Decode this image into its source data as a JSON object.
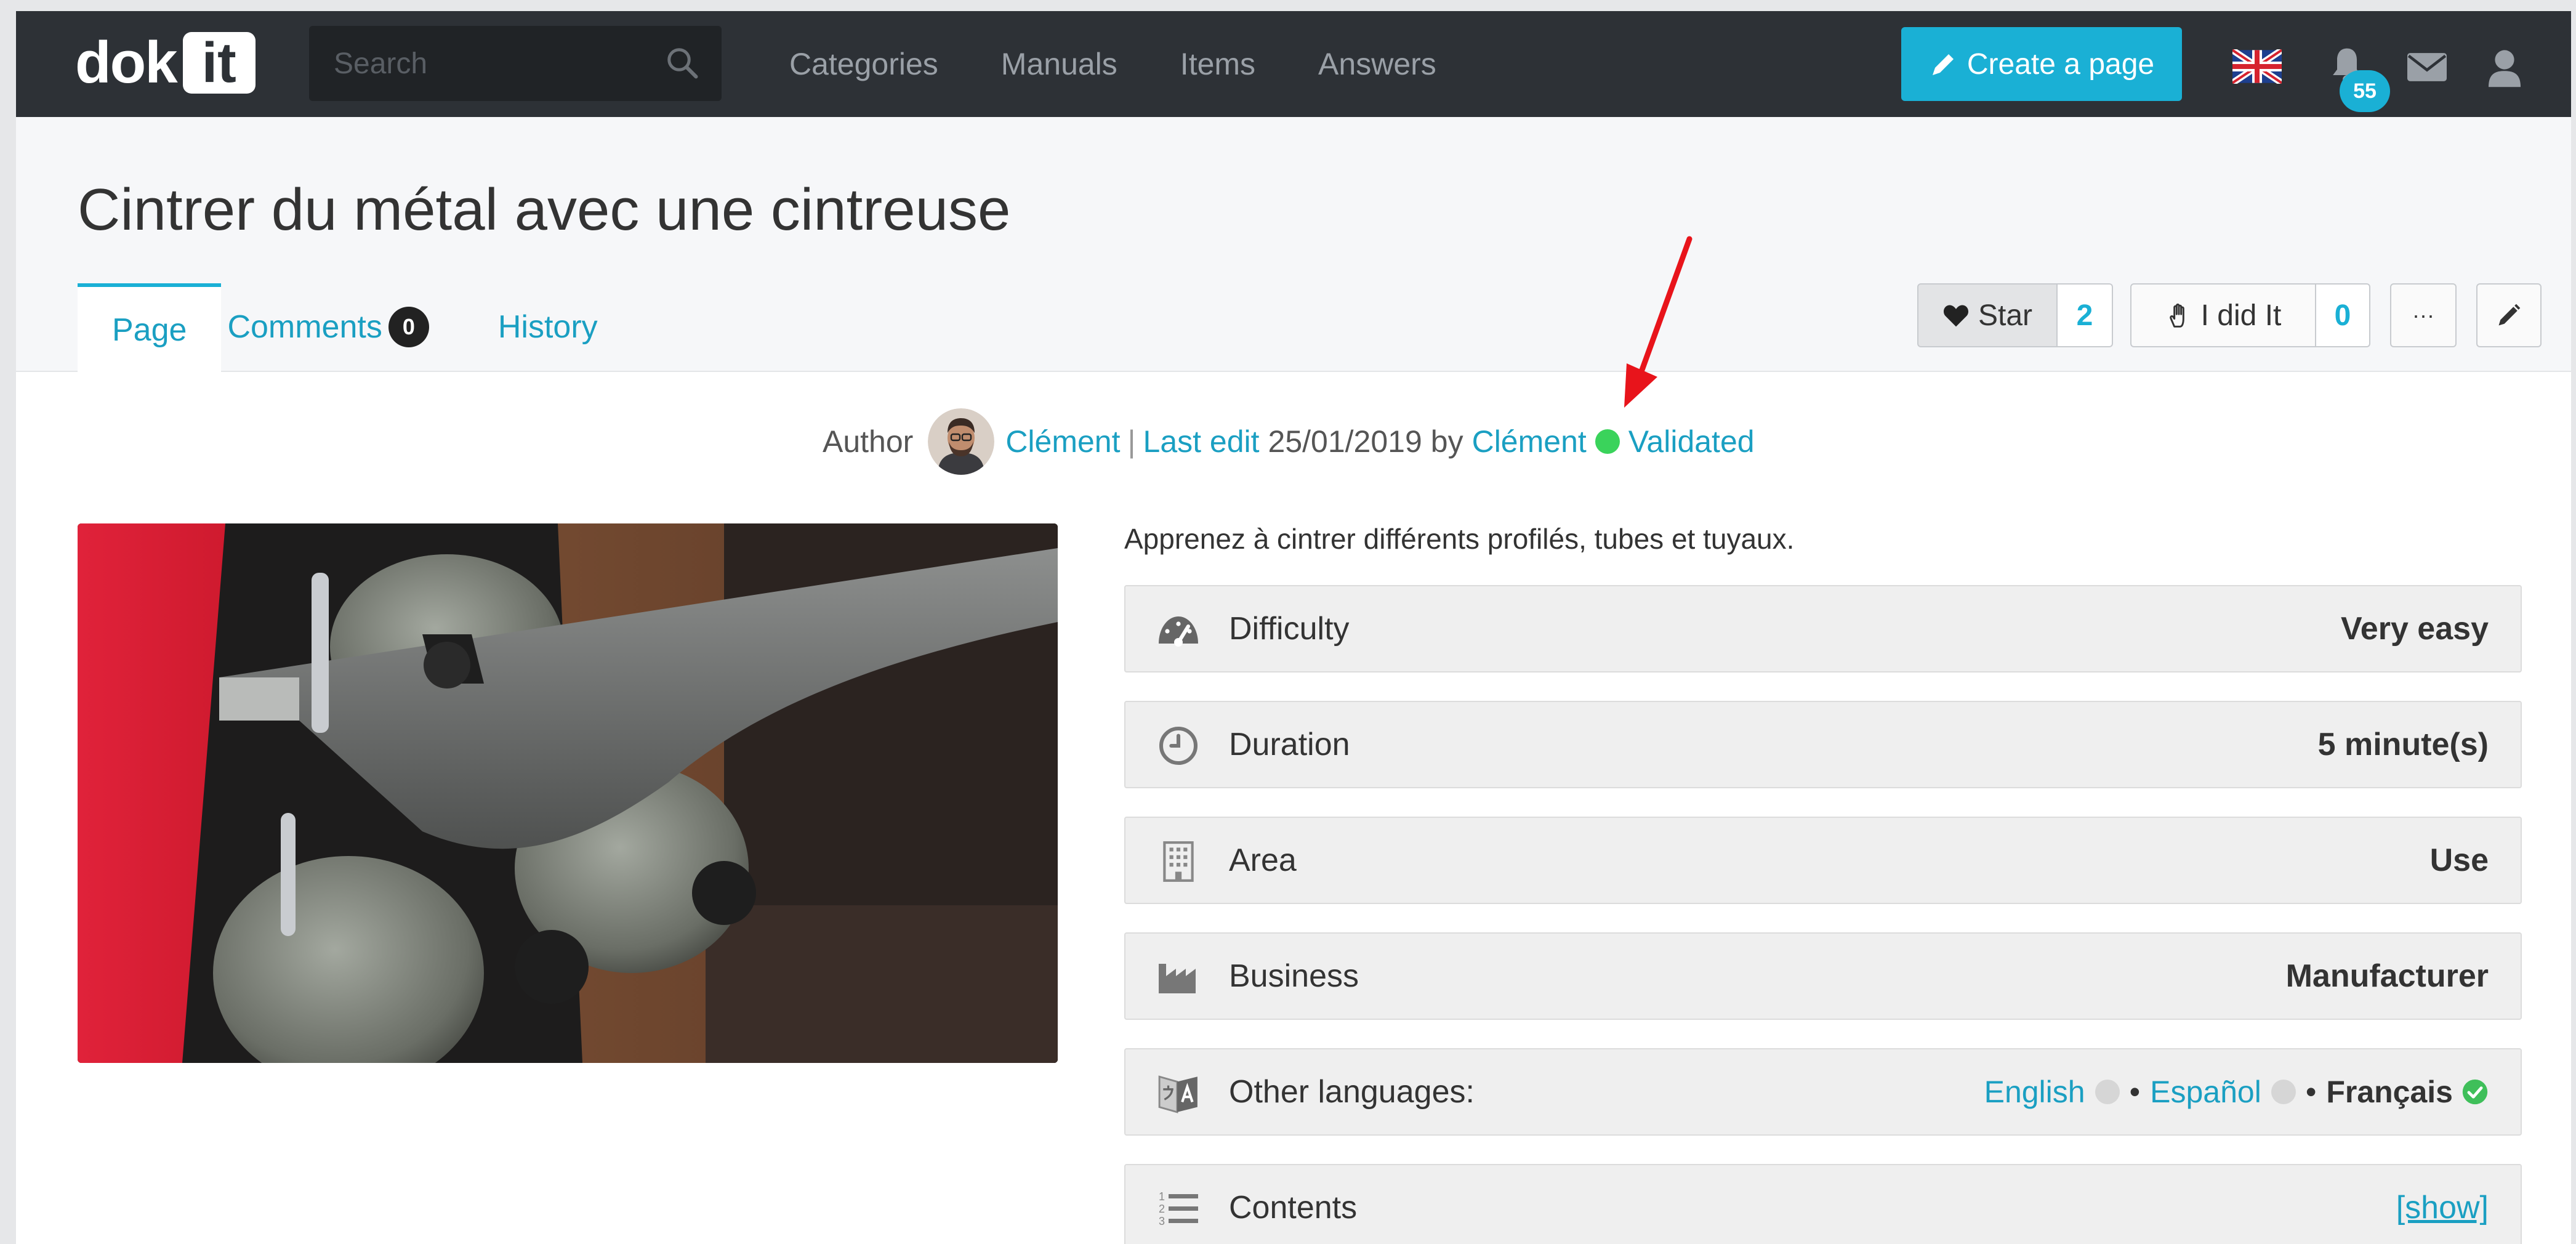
{
  "brand": {
    "logo_text": "dok",
    "logo_box": "it"
  },
  "search": {
    "placeholder": "Search"
  },
  "nav": {
    "items": [
      "Categories",
      "Manuals",
      "Items",
      "Answers"
    ]
  },
  "create_button": {
    "label": "Create a page"
  },
  "notifications": {
    "count": "55"
  },
  "page": {
    "title": "Cintrer du métal avec une cintreuse",
    "tabs": {
      "page": "Page",
      "comments": "Comments",
      "comments_count": "0",
      "history": "History"
    }
  },
  "actions": {
    "star_label": "Star",
    "star_count": "2",
    "did_label": "I did It",
    "did_count": "0",
    "more_label": "···"
  },
  "meta": {
    "author_label": "Author",
    "author_name": "Clément",
    "separator": "|",
    "last_edit_label": "Last edit",
    "last_edit_date": "25/01/2019",
    "by_label": "by",
    "editor_name": "Clément",
    "status": "Validated"
  },
  "intro": "Apprenez à cintrer différents profilés, tubes et tuyaux.",
  "info": {
    "difficulty": {
      "label": "Difficulty",
      "value": "Very easy"
    },
    "duration": {
      "label": "Duration",
      "value": "5 minute(s)"
    },
    "area": {
      "label": "Area",
      "value": "Use"
    },
    "business": {
      "label": "Business",
      "value": "Manufacturer"
    },
    "languages": {
      "label": "Other languages:",
      "items": [
        "English",
        "Español",
        "Français"
      ],
      "bullet": "•"
    },
    "contents": {
      "label": "Contents",
      "value": "[show]"
    }
  },
  "colors": {
    "accent": "#1ab0d5",
    "topbar": "#2d3136",
    "validated": "#3ad35b",
    "annotation": "#e8141b"
  }
}
